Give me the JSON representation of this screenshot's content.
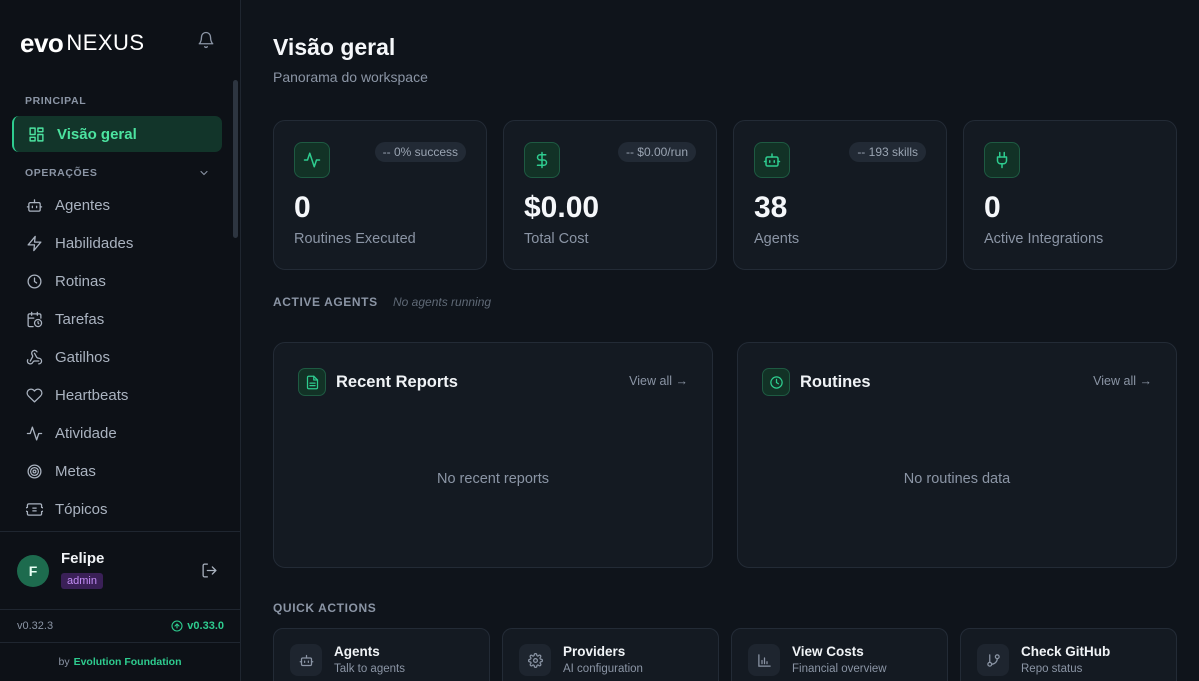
{
  "brand": {
    "evo": "evo",
    "nexus": "NEXUS"
  },
  "sidebar": {
    "section_principal": "PRINCIPAL",
    "active_item": {
      "label": "Visão geral",
      "icon": "dashboard-grid-icon"
    },
    "section_operacoes": "OPERAÇÕES",
    "items": [
      {
        "label": "Agentes",
        "icon": "bot-icon"
      },
      {
        "label": "Habilidades",
        "icon": "lightning-icon"
      },
      {
        "label": "Rotinas",
        "icon": "clock-icon"
      },
      {
        "label": "Tarefas",
        "icon": "calendar-clock-icon"
      },
      {
        "label": "Gatilhos",
        "icon": "webhook-icon"
      },
      {
        "label": "Heartbeats",
        "icon": "heart-icon"
      },
      {
        "label": "Atividade",
        "icon": "activity-icon"
      },
      {
        "label": "Metas",
        "icon": "target-icon"
      },
      {
        "label": "Tópicos",
        "icon": "ticket-icon"
      }
    ]
  },
  "user": {
    "initial": "F",
    "name": "Felipe",
    "role": "admin"
  },
  "version": {
    "current": "v0.32.3",
    "available": "v0.33.0"
  },
  "byline": {
    "prefix": "by",
    "org": "Evolution Foundation"
  },
  "page": {
    "title": "Visão geral",
    "subtitle": "Panorama do workspace"
  },
  "stats": [
    {
      "value": "0",
      "label": "Routines Executed",
      "badge": "-- 0% success",
      "icon": "activity-icon"
    },
    {
      "value": "$0.00",
      "label": "Total Cost",
      "badge": "-- $0.00/run",
      "icon": "dollar-icon"
    },
    {
      "value": "38",
      "label": "Agents",
      "badge": "-- 193 skills",
      "icon": "bot-icon"
    },
    {
      "value": "0",
      "label": "Active Integrations",
      "badge": "",
      "icon": "plug-icon"
    }
  ],
  "active_agents": {
    "label": "ACTIVE AGENTS",
    "status": "No agents running"
  },
  "panels": [
    {
      "title": "Recent Reports",
      "view_all": "View all →",
      "empty": "No recent reports",
      "icon": "file-text-icon"
    },
    {
      "title": "Routines",
      "view_all": "View all →",
      "empty": "No routines data",
      "icon": "clock-icon"
    }
  ],
  "quick_actions": {
    "label": "QUICK ACTIONS",
    "items": [
      {
        "title": "Agents",
        "sub": "Talk to agents",
        "icon": "bot-icon"
      },
      {
        "title": "Providers",
        "sub": "AI configuration",
        "icon": "gear-icon"
      },
      {
        "title": "View Costs",
        "sub": "Financial overview",
        "icon": "bar-chart-icon"
      },
      {
        "title": "Check GitHub",
        "sub": "Repo status",
        "icon": "git-branch-icon"
      }
    ]
  },
  "colors": {
    "accent": "#2ecc8f",
    "background": "#0f141b",
    "card": "#141a22",
    "role_badge": "#c28cf5"
  }
}
